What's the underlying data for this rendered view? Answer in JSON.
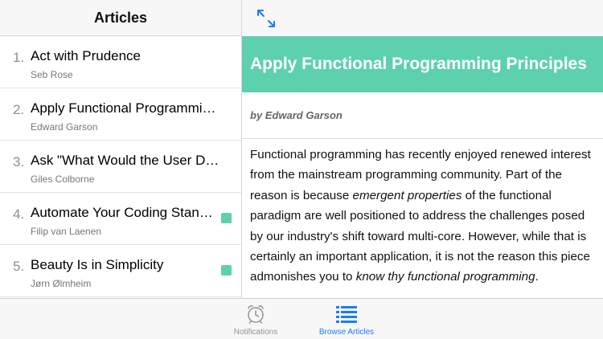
{
  "sidebar": {
    "title": "Articles",
    "items": [
      {
        "number": "1.",
        "title": "Act with Prudence",
        "author": "Seb Rose",
        "read": false
      },
      {
        "number": "2.",
        "title": "Apply Functional Programming Principles",
        "author": "Edward Garson",
        "read": false
      },
      {
        "number": "3.",
        "title": "Ask \"What Would the User Do?\"",
        "author": "Giles Colborne",
        "read": false
      },
      {
        "number": "4.",
        "title": "Automate Your Coding Standard",
        "author": "Filip van Laenen",
        "read": true
      },
      {
        "number": "5.",
        "title": "Beauty Is in Simplicity",
        "author": "Jørn Ølmheim",
        "read": true
      }
    ]
  },
  "detail": {
    "toolbar_icon": "expand-icon",
    "title": "Apply Functional Programming Principles",
    "byline": "by Edward Garson",
    "body": [
      {
        "text": "Functional programming has recently enjoyed renewed interest from the mainstream programming community. Part of the reason is because ",
        "em": false
      },
      {
        "text": "emergent properties",
        "em": true
      },
      {
        "text": " of the functional paradigm are well positioned to address the challenges posed by our industry's shift toward multi-core. However, while that is certainly an important application, it is not the reason this piece admonishes you to ",
        "em": false
      },
      {
        "text": "know thy functional programming",
        "em": true
      },
      {
        "text": ".",
        "em": false
      }
    ]
  },
  "tabbar": {
    "notifications": {
      "label": "Notifications",
      "icon": "alarm-clock-icon"
    },
    "browse": {
      "label": "Browse Articles",
      "icon": "list-icon"
    }
  },
  "colors": {
    "accent_green": "#5dd1ad",
    "tab_active_blue": "#1b7cf5",
    "tab_inactive_gray": "#929292"
  }
}
